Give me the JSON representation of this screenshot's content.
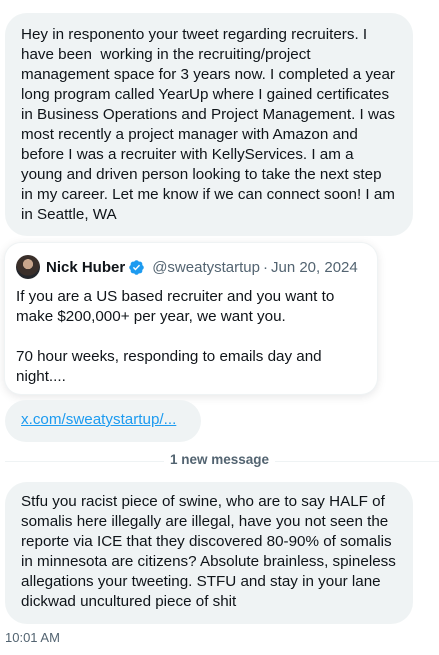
{
  "messages": {
    "first": "Hey in responento your tweet regarding recruiters. I have been  working in the recruiting/project management space for 3 years now. I completed a year long program called YearUp where I gained certificates in Business Operations and Project Management. I was most recently a project manager with Amazon and before I was a recruiter with KellyServices. I am a young and driven person looking to take the next step in my career. Let me know if we can connect soon! I am in Seattle, WA",
    "link": "x.com/sweatystartup/...",
    "new_message_label": "1 new message",
    "second": "Stfu you racist piece of swine, who are to say HALF of somalis here illegally are illegal, have you not seen the reporte via ICE that they discovered 80-90% of somalis in minnesota are citizens? Absolute brainless, spineless allegations your tweeting. STFU and stay in your lane dickwad uncultured piece of shit",
    "timestamp": "10:01 AM"
  },
  "quoted_tweet": {
    "author_name": "Nick Huber",
    "handle": "@sweatystartup",
    "separator": "·",
    "date": "Jun 20, 2024",
    "text": "If you are a US based recruiter and you want to make $200,000+ per year, we want you.\n\n70 hour weeks, responding to emails day and night....",
    "avatar_icon": "user-avatar",
    "verified_icon": "verified-badge-icon"
  },
  "colors": {
    "bubble_bg": "#eff3f4",
    "text": "#0f1419",
    "secondary_text": "#536471",
    "link": "#1d9bf0",
    "verified": "#1d9bf0"
  }
}
